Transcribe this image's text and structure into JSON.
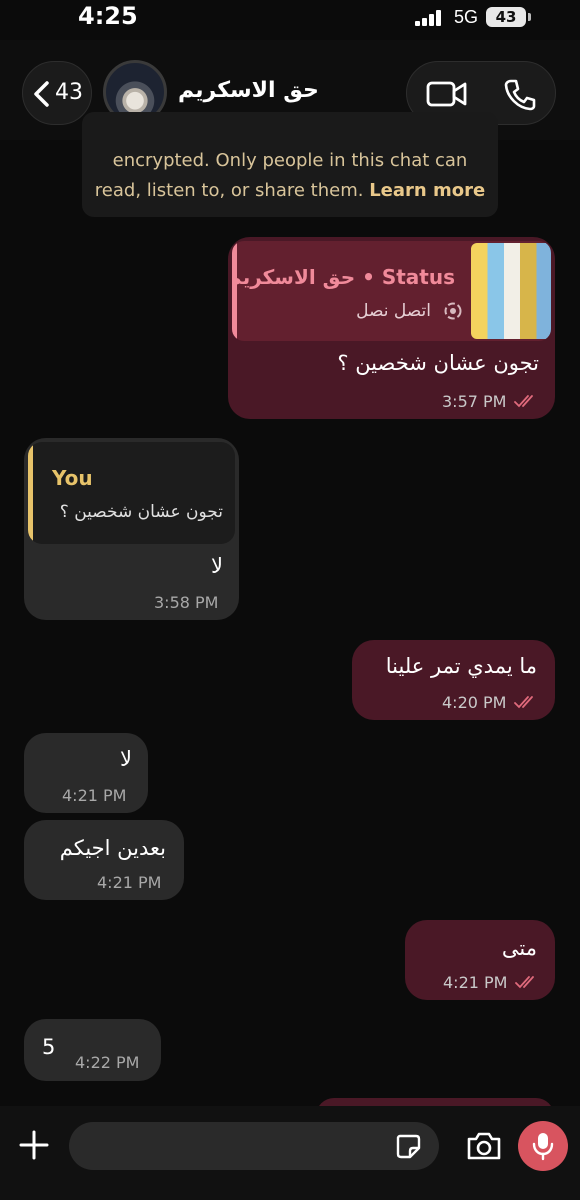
{
  "status_bar": {
    "time": "4:25",
    "network": "5G",
    "battery": "43"
  },
  "header": {
    "back_count": "43",
    "chat_name": "حق الاسكريم"
  },
  "encryption_notice": {
    "line1": "encrypted. Only people in this chat can",
    "line2_prefix": "read, listen to, or share them.",
    "learn_more": "Learn more"
  },
  "messages": [
    {
      "direction": "out",
      "reply": {
        "title": "Status • حق الاسكريم",
        "subtitle": "اتصل نصل"
      },
      "text": "تجون عشان شخصين ؟",
      "time": "3:57 PM"
    },
    {
      "direction": "in",
      "reply": {
        "title": "You",
        "subtitle": "تجون عشان شخصين ؟"
      },
      "text": "لا",
      "time": "3:58 PM"
    },
    {
      "direction": "out",
      "text": "ما يمدي تمر علينا",
      "time": "4:20 PM"
    },
    {
      "direction": "in",
      "text": "لا",
      "time": "4:21 PM"
    },
    {
      "direction": "in",
      "text": "بعدين اجيكم",
      "time": "4:21 PM"
    },
    {
      "direction": "out",
      "text": "متى",
      "time": "4:21 PM"
    },
    {
      "direction": "in",
      "text": "5",
      "time": "4:22 PM"
    }
  ],
  "colors": {
    "outgoing": "#4a1826",
    "incoming": "#2a2a2a",
    "read_tick": "#e06a7c",
    "mic": "#d8545f"
  },
  "icons": [
    "chevron-left-icon",
    "video-call-icon",
    "phone-icon",
    "plus-icon",
    "sticker-icon",
    "camera-icon",
    "microphone-icon",
    "status-ring-icon"
  ]
}
